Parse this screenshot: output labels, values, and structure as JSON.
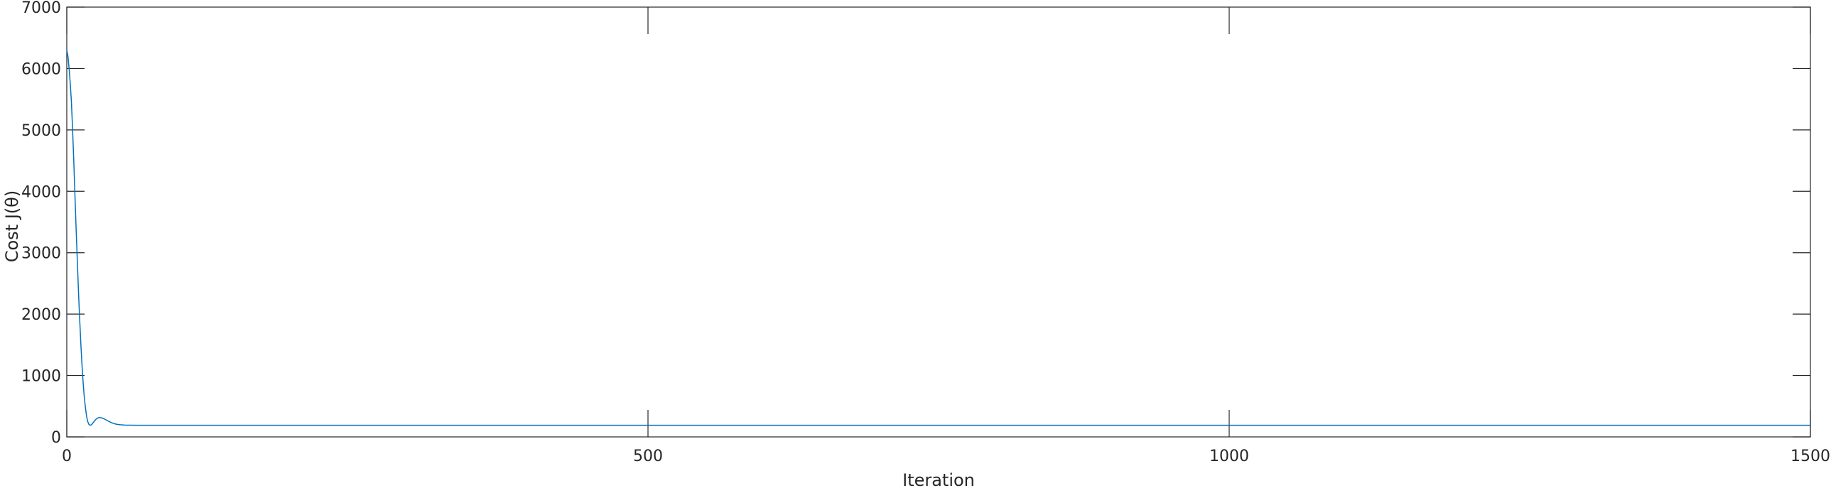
{
  "chart_data": {
    "type": "line",
    "title": "",
    "xlabel": "Iteration",
    "ylabel": "Cost J(θ)",
    "xlim": [
      0,
      1500
    ],
    "ylim": [
      0,
      7000
    ],
    "xticks": [
      0,
      500,
      1000,
      1500
    ],
    "yticks": [
      0,
      1000,
      2000,
      3000,
      4000,
      5000,
      6000,
      7000
    ],
    "grid": false,
    "box": true,
    "line_color": "#0072BD",
    "axis_color": "#262626",
    "series": [
      {
        "x": [
          0,
          1,
          2,
          3,
          4,
          5,
          6,
          7,
          8,
          9,
          10,
          11,
          12,
          13,
          14,
          15,
          16,
          17,
          18,
          19,
          20,
          21,
          22,
          23,
          24,
          25,
          26,
          27,
          28,
          30,
          32,
          34,
          36,
          38,
          40,
          42,
          44,
          46,
          48,
          50,
          55,
          60,
          65,
          70,
          80,
          90,
          100,
          150,
          200,
          300,
          500,
          1000,
          1500
        ],
        "values": [
          6300,
          6200,
          6000,
          5750,
          5450,
          5000,
          4500,
          3950,
          3400,
          2900,
          2400,
          1950,
          1550,
          1200,
          900,
          660,
          480,
          340,
          250,
          205,
          190,
          195,
          215,
          240,
          265,
          285,
          300,
          310,
          315,
          310,
          295,
          275,
          255,
          235,
          220,
          210,
          203,
          198,
          195,
          192,
          191,
          190,
          190,
          190,
          190,
          190,
          190,
          190,
          190,
          190,
          190,
          190,
          190
        ]
      }
    ]
  }
}
